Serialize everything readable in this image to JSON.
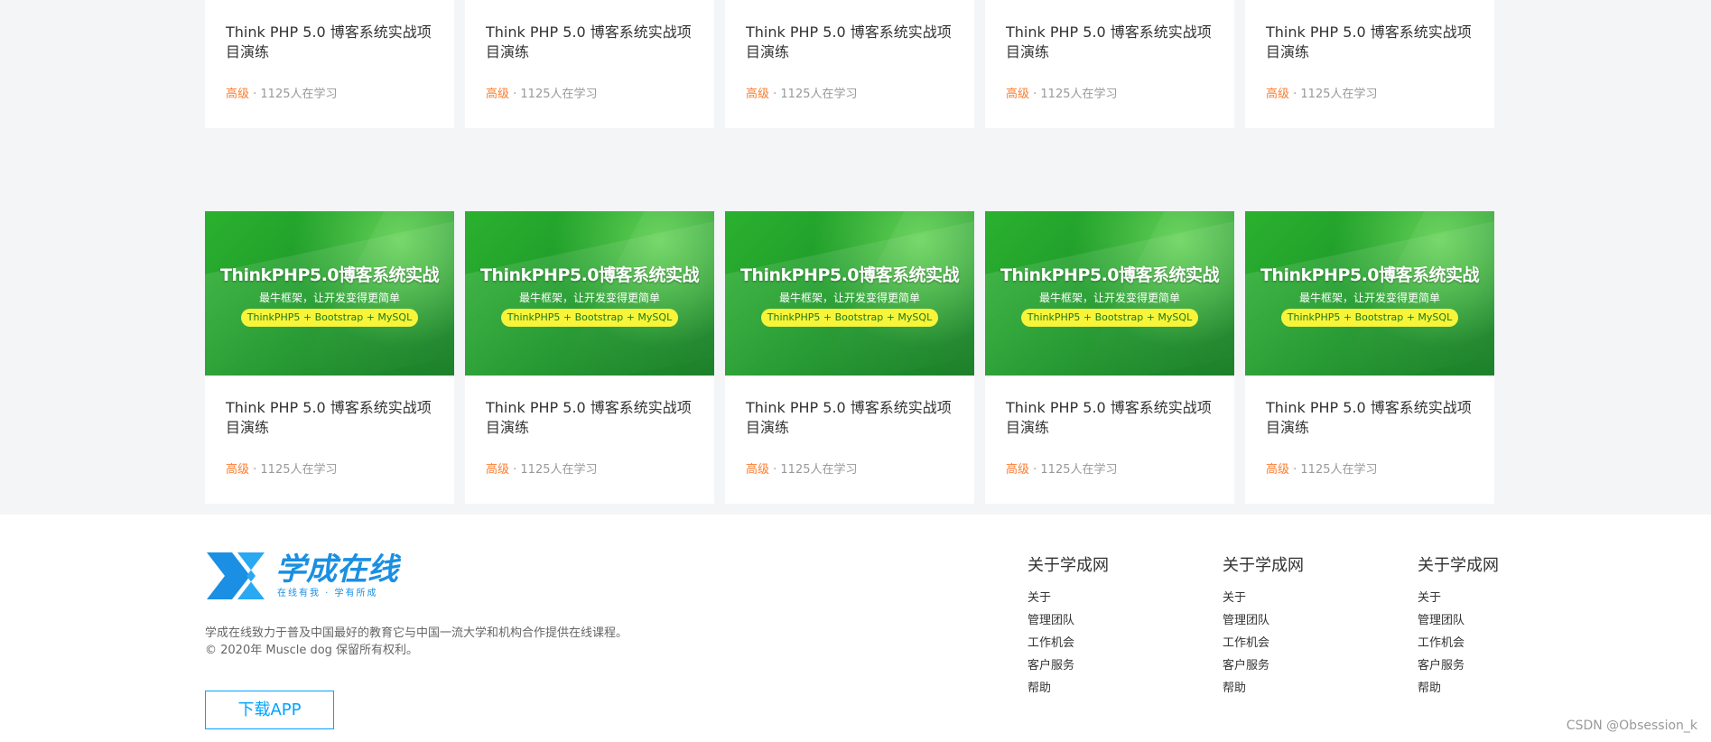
{
  "courses": {
    "banner": {
      "title": "ThinkPHP5.0博客系统实战",
      "subtitle": "最牛框架，让开发变得更简单",
      "pill": "ThinkPHP5 + Bootstrap + MySQL"
    },
    "rows": [
      [
        {
          "title": "Think PHP 5.0 博客系统实战项目演练",
          "level": "高级",
          "meta": " · 1125人在学习"
        },
        {
          "title": "Think PHP 5.0 博客系统实战项目演练",
          "level": "高级",
          "meta": " · 1125人在学习"
        },
        {
          "title": "Think PHP 5.0 博客系统实战项目演练",
          "level": "高级",
          "meta": " · 1125人在学习"
        },
        {
          "title": "Think PHP 5.0 博客系统实战项目演练",
          "level": "高级",
          "meta": " · 1125人在学习"
        },
        {
          "title": "Think PHP 5.0 博客系统实战项目演练",
          "level": "高级",
          "meta": " · 1125人在学习"
        }
      ],
      [
        {
          "title": "Think PHP 5.0 博客系统实战项目演练",
          "level": "高级",
          "meta": " · 1125人在学习"
        },
        {
          "title": "Think PHP 5.0 博客系统实战项目演练",
          "level": "高级",
          "meta": " · 1125人在学习"
        },
        {
          "title": "Think PHP 5.0 博客系统实战项目演练",
          "level": "高级",
          "meta": " · 1125人在学习"
        },
        {
          "title": "Think PHP 5.0 博客系统实战项目演练",
          "level": "高级",
          "meta": " · 1125人在学习"
        },
        {
          "title": "Think PHP 5.0 博客系统实战项目演练",
          "level": "高级",
          "meta": " · 1125人在学习"
        }
      ]
    ]
  },
  "footer": {
    "logo": {
      "main": "学成在线",
      "tagline": "在线有我 · 学有所成"
    },
    "description": "学成在线致力于普及中国最好的教育它与中国一流大学和机构合作提供在线课程。",
    "copyright": "© 2020年 Muscle dog 保留所有权利。",
    "download_label": "下载APP",
    "columns": [
      {
        "title": "关于学成网",
        "links": [
          "关于",
          "管理团队",
          "工作机会",
          "客户服务",
          "帮助"
        ]
      },
      {
        "title": "关于学成网",
        "links": [
          "关于",
          "管理团队",
          "工作机会",
          "客户服务",
          "帮助"
        ]
      },
      {
        "title": "关于学成网",
        "links": [
          "关于",
          "管理团队",
          "工作机会",
          "客户服务",
          "帮助"
        ]
      }
    ]
  },
  "watermark": "CSDN @Obsession_k",
  "colors": {
    "accent": "#00a4ff",
    "level": "#ff7c2d",
    "banner_green": "#1e9a2a",
    "pill_yellow": "#f7f43a"
  }
}
